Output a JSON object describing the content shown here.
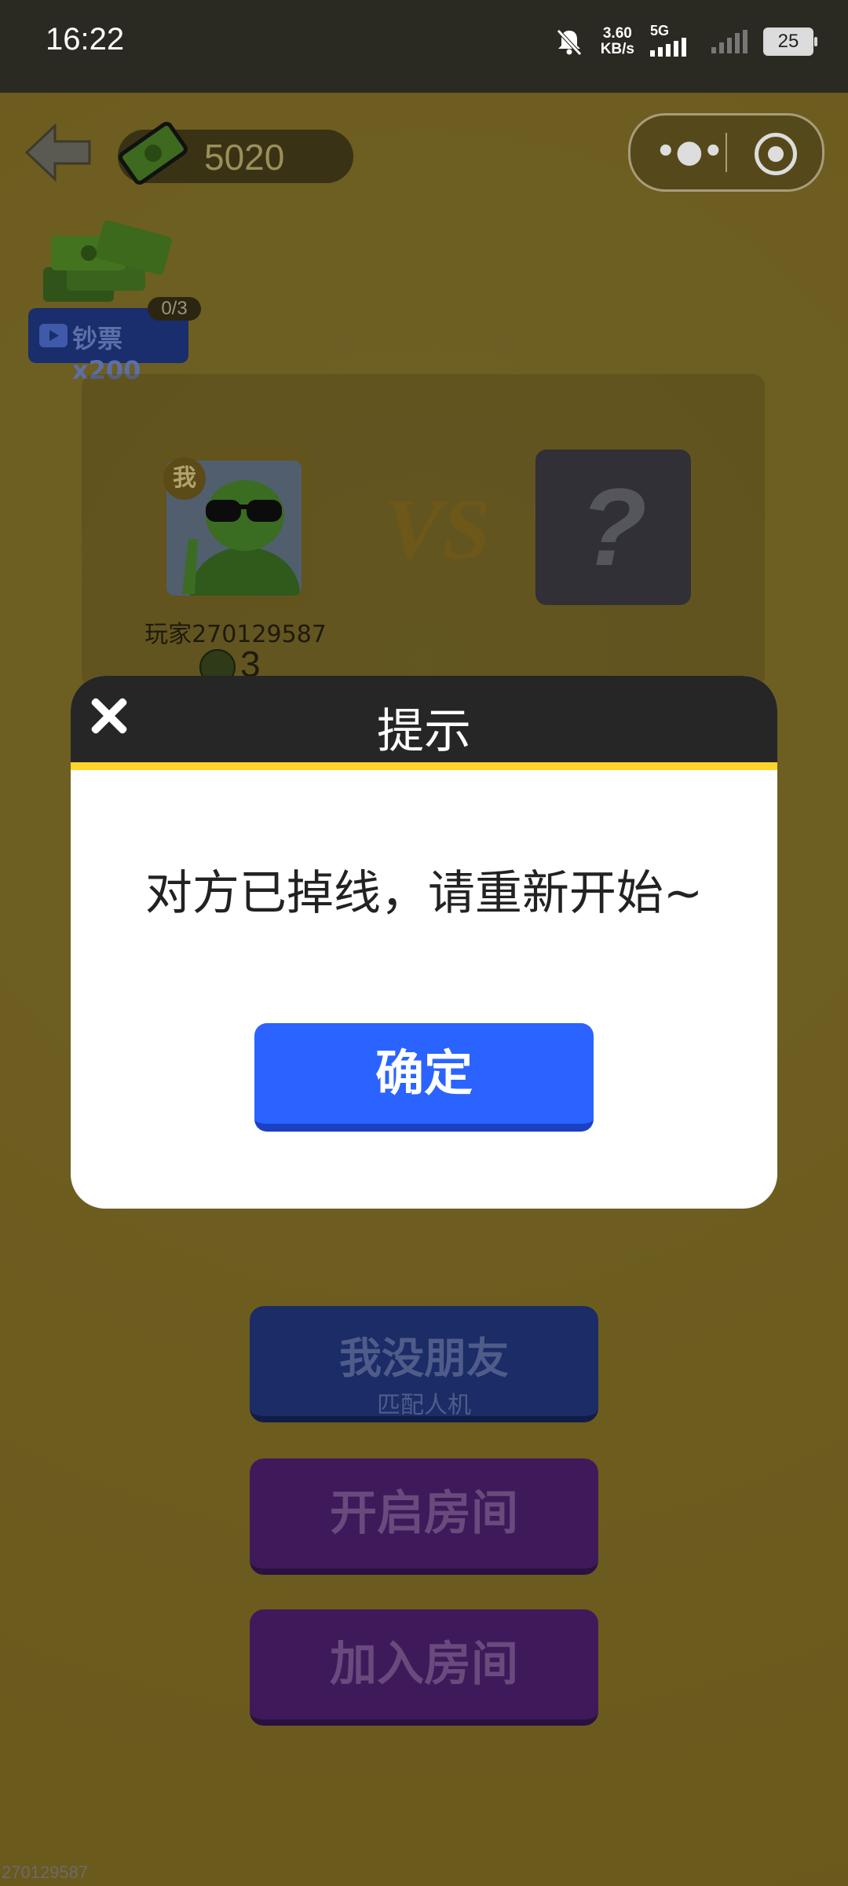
{
  "status_bar": {
    "time": "16:22",
    "net_speed_value": "3.60",
    "net_speed_unit": "KB/s",
    "network": "5G",
    "battery": "25"
  },
  "topbar": {
    "cash_amount": "5020"
  },
  "reward": {
    "count": "0/3",
    "label": "钞票x200"
  },
  "match": {
    "me_badge": "我",
    "vs": "VS",
    "opponent_placeholder": "?",
    "player_name": "玩家270129587",
    "lives": "3"
  },
  "menu": {
    "robot_title": "我没朋友",
    "robot_sub": "匹配人机",
    "open_room": "开启房间",
    "join_room": "加入房间"
  },
  "dialog": {
    "title": "提示",
    "message": "对方已掉线，请重新开始~",
    "confirm": "确定"
  },
  "footer": {
    "user_id": "270129587"
  },
  "colors": {
    "background": "#f2cf3f",
    "dialog_header": "#262626",
    "accent_yellow": "#ffd42a",
    "confirm_blue": "#2a63ff"
  },
  "icons": [
    "back-arrow-icon",
    "cash-icon",
    "more-dots-icon",
    "target-icon",
    "video-icon",
    "close-icon",
    "dead-face-icon",
    "mute-bell-icon",
    "signal-icon"
  ]
}
